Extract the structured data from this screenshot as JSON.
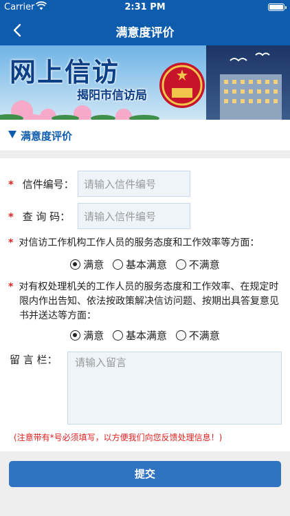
{
  "status_bar": {
    "carrier": "Carrier",
    "time": "2:31 PM"
  },
  "nav": {
    "title": "满意度评价",
    "back_icon": "chevron-left-icon"
  },
  "banner": {
    "title": "网上信访",
    "subtitle": "揭阳市信访局"
  },
  "section": {
    "title": "满意度评价"
  },
  "form": {
    "letter_no_label": "信件编号：",
    "letter_no_placeholder": "请输入信件编号",
    "query_code_label": "查 询 码：",
    "query_code_placeholder": "请输入信件编号",
    "q1": "对信访工作机构工作人员的服务态度和工作效率等方面：",
    "q2_line1": "对有权处理机关的工作人员的服务态度和工作效率、在规定时",
    "q2_line2": "限内作出告知、依法按政策解决信访问题、按期出具答复意见",
    "q2_line3": "书并送达等方面：",
    "options": {
      "satisfied": "满意",
      "basic": "基本满意",
      "unsatisfied": "不满意"
    },
    "q1_selected": "满意",
    "q2_selected": "满意",
    "message_label": "留 言 栏：",
    "message_placeholder": "请输入留言",
    "required_mark": "*",
    "note": "(注意带有*号必须填写，以方便我们向您反馈处理信息！)"
  },
  "submit_label": "提交",
  "colors": {
    "primary": "#0d5cae",
    "button": "#2f73c2",
    "required": "#e02020"
  }
}
